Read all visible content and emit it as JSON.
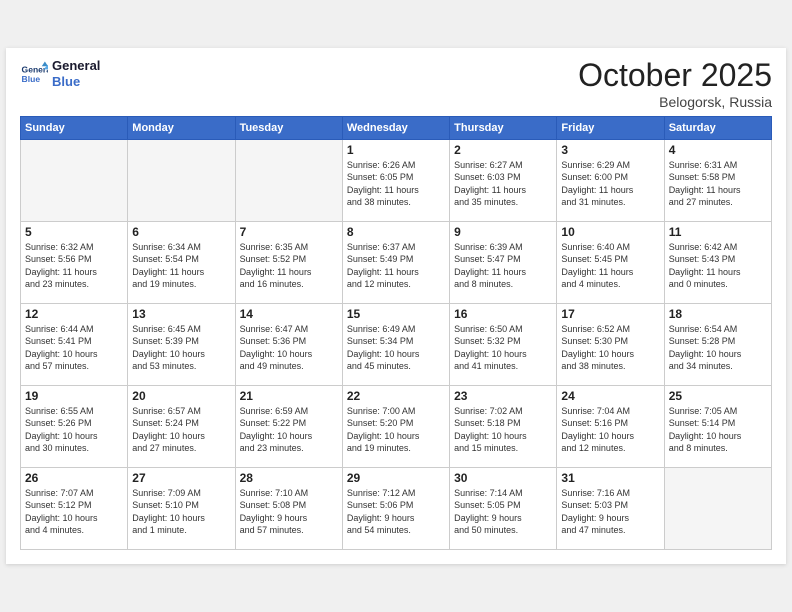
{
  "header": {
    "logo_line1": "General",
    "logo_line2": "Blue",
    "month": "October 2025",
    "location": "Belogorsk, Russia"
  },
  "weekdays": [
    "Sunday",
    "Monday",
    "Tuesday",
    "Wednesday",
    "Thursday",
    "Friday",
    "Saturday"
  ],
  "weeks": [
    [
      {
        "day": "",
        "info": ""
      },
      {
        "day": "",
        "info": ""
      },
      {
        "day": "",
        "info": ""
      },
      {
        "day": "1",
        "info": "Sunrise: 6:26 AM\nSunset: 6:05 PM\nDaylight: 11 hours\nand 38 minutes."
      },
      {
        "day": "2",
        "info": "Sunrise: 6:27 AM\nSunset: 6:03 PM\nDaylight: 11 hours\nand 35 minutes."
      },
      {
        "day": "3",
        "info": "Sunrise: 6:29 AM\nSunset: 6:00 PM\nDaylight: 11 hours\nand 31 minutes."
      },
      {
        "day": "4",
        "info": "Sunrise: 6:31 AM\nSunset: 5:58 PM\nDaylight: 11 hours\nand 27 minutes."
      }
    ],
    [
      {
        "day": "5",
        "info": "Sunrise: 6:32 AM\nSunset: 5:56 PM\nDaylight: 11 hours\nand 23 minutes."
      },
      {
        "day": "6",
        "info": "Sunrise: 6:34 AM\nSunset: 5:54 PM\nDaylight: 11 hours\nand 19 minutes."
      },
      {
        "day": "7",
        "info": "Sunrise: 6:35 AM\nSunset: 5:52 PM\nDaylight: 11 hours\nand 16 minutes."
      },
      {
        "day": "8",
        "info": "Sunrise: 6:37 AM\nSunset: 5:49 PM\nDaylight: 11 hours\nand 12 minutes."
      },
      {
        "day": "9",
        "info": "Sunrise: 6:39 AM\nSunset: 5:47 PM\nDaylight: 11 hours\nand 8 minutes."
      },
      {
        "day": "10",
        "info": "Sunrise: 6:40 AM\nSunset: 5:45 PM\nDaylight: 11 hours\nand 4 minutes."
      },
      {
        "day": "11",
        "info": "Sunrise: 6:42 AM\nSunset: 5:43 PM\nDaylight: 11 hours\nand 0 minutes."
      }
    ],
    [
      {
        "day": "12",
        "info": "Sunrise: 6:44 AM\nSunset: 5:41 PM\nDaylight: 10 hours\nand 57 minutes."
      },
      {
        "day": "13",
        "info": "Sunrise: 6:45 AM\nSunset: 5:39 PM\nDaylight: 10 hours\nand 53 minutes."
      },
      {
        "day": "14",
        "info": "Sunrise: 6:47 AM\nSunset: 5:36 PM\nDaylight: 10 hours\nand 49 minutes."
      },
      {
        "day": "15",
        "info": "Sunrise: 6:49 AM\nSunset: 5:34 PM\nDaylight: 10 hours\nand 45 minutes."
      },
      {
        "day": "16",
        "info": "Sunrise: 6:50 AM\nSunset: 5:32 PM\nDaylight: 10 hours\nand 41 minutes."
      },
      {
        "day": "17",
        "info": "Sunrise: 6:52 AM\nSunset: 5:30 PM\nDaylight: 10 hours\nand 38 minutes."
      },
      {
        "day": "18",
        "info": "Sunrise: 6:54 AM\nSunset: 5:28 PM\nDaylight: 10 hours\nand 34 minutes."
      }
    ],
    [
      {
        "day": "19",
        "info": "Sunrise: 6:55 AM\nSunset: 5:26 PM\nDaylight: 10 hours\nand 30 minutes."
      },
      {
        "day": "20",
        "info": "Sunrise: 6:57 AM\nSunset: 5:24 PM\nDaylight: 10 hours\nand 27 minutes."
      },
      {
        "day": "21",
        "info": "Sunrise: 6:59 AM\nSunset: 5:22 PM\nDaylight: 10 hours\nand 23 minutes."
      },
      {
        "day": "22",
        "info": "Sunrise: 7:00 AM\nSunset: 5:20 PM\nDaylight: 10 hours\nand 19 minutes."
      },
      {
        "day": "23",
        "info": "Sunrise: 7:02 AM\nSunset: 5:18 PM\nDaylight: 10 hours\nand 15 minutes."
      },
      {
        "day": "24",
        "info": "Sunrise: 7:04 AM\nSunset: 5:16 PM\nDaylight: 10 hours\nand 12 minutes."
      },
      {
        "day": "25",
        "info": "Sunrise: 7:05 AM\nSunset: 5:14 PM\nDaylight: 10 hours\nand 8 minutes."
      }
    ],
    [
      {
        "day": "26",
        "info": "Sunrise: 7:07 AM\nSunset: 5:12 PM\nDaylight: 10 hours\nand 4 minutes."
      },
      {
        "day": "27",
        "info": "Sunrise: 7:09 AM\nSunset: 5:10 PM\nDaylight: 10 hours\nand 1 minute."
      },
      {
        "day": "28",
        "info": "Sunrise: 7:10 AM\nSunset: 5:08 PM\nDaylight: 9 hours\nand 57 minutes."
      },
      {
        "day": "29",
        "info": "Sunrise: 7:12 AM\nSunset: 5:06 PM\nDaylight: 9 hours\nand 54 minutes."
      },
      {
        "day": "30",
        "info": "Sunrise: 7:14 AM\nSunset: 5:05 PM\nDaylight: 9 hours\nand 50 minutes."
      },
      {
        "day": "31",
        "info": "Sunrise: 7:16 AM\nSunset: 5:03 PM\nDaylight: 9 hours\nand 47 minutes."
      },
      {
        "day": "",
        "info": ""
      }
    ]
  ]
}
